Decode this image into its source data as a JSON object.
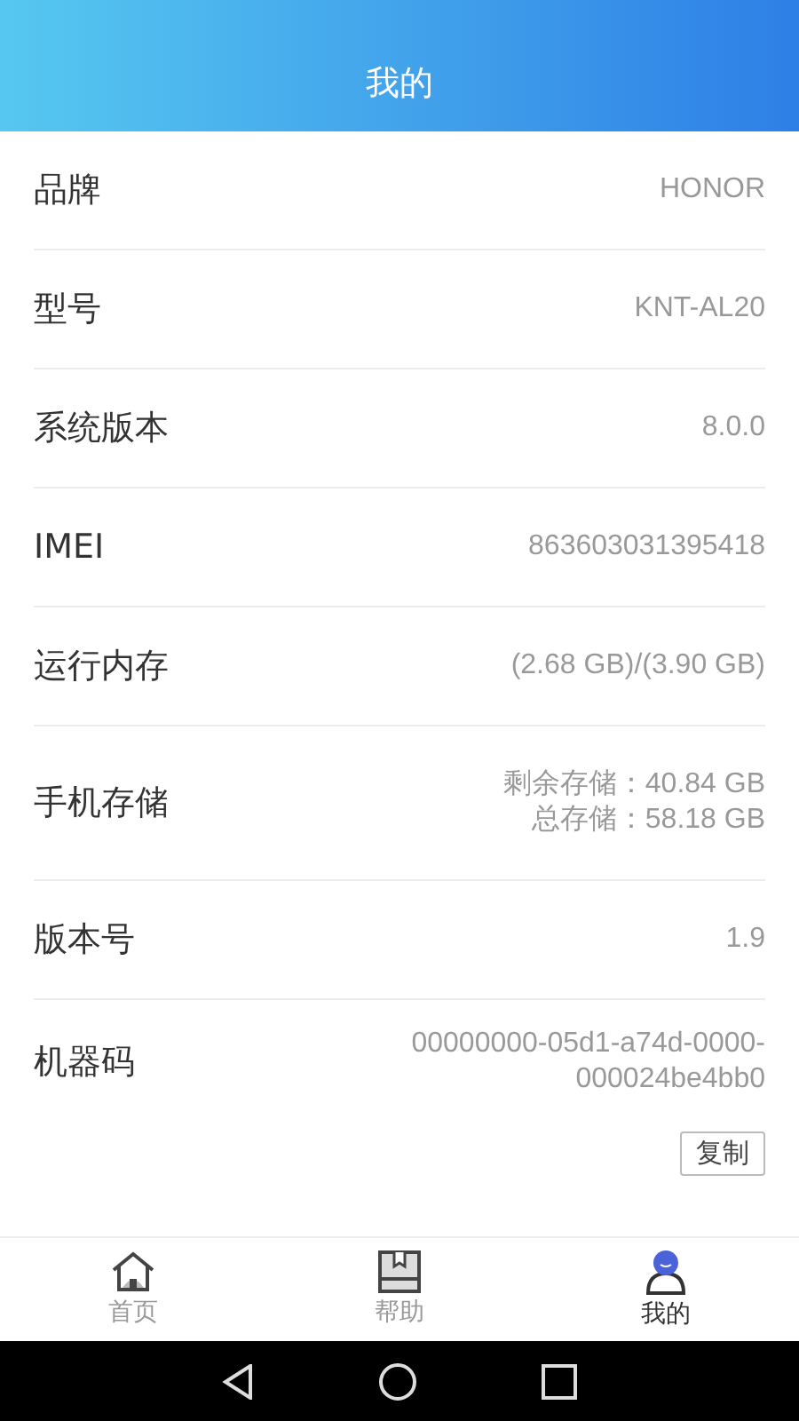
{
  "header": {
    "title": "我的"
  },
  "info_rows": [
    {
      "label": "品牌",
      "lines": [
        "HONOR"
      ]
    },
    {
      "label": "型号",
      "lines": [
        "KNT-AL20"
      ]
    },
    {
      "label": "系统版本",
      "lines": [
        "8.0.0"
      ]
    },
    {
      "label": "IMEI",
      "lines": [
        "863603031395418"
      ]
    },
    {
      "label": "运行内存",
      "lines": [
        "(2.68 GB)/(3.90 GB)"
      ]
    },
    {
      "label": "手机存储",
      "lines": [
        "剩余存储：40.84 GB",
        "总存储：58.18 GB"
      ]
    },
    {
      "label": "版本号",
      "lines": [
        "1.9"
      ]
    },
    {
      "label": "机器码",
      "lines": [
        "00000000-05d1-a74d-0000-",
        "000024be4bb0"
      ]
    }
  ],
  "copy_button": "复制",
  "tabs": [
    {
      "label": "首页",
      "kind": "home",
      "selected": false
    },
    {
      "label": "帮助",
      "kind": "help",
      "selected": false
    },
    {
      "label": "我的",
      "kind": "me",
      "selected": true
    }
  ]
}
